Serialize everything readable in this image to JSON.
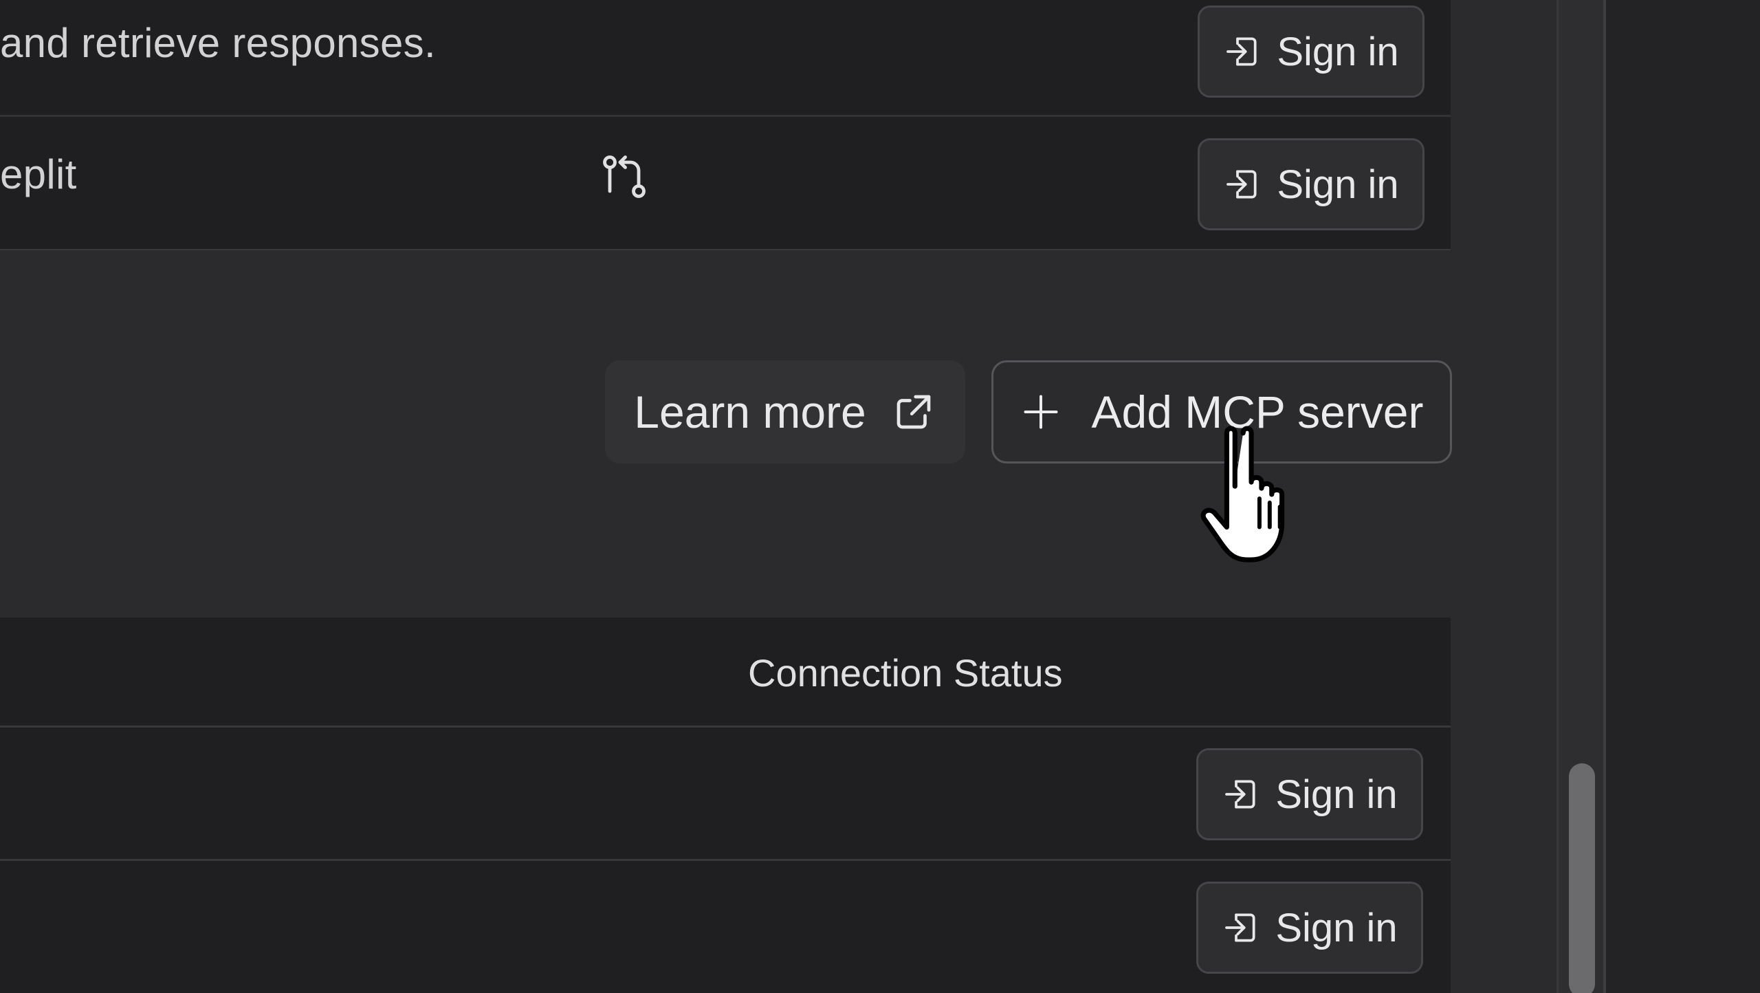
{
  "top_list": {
    "rows": [
      {
        "text": "and retrieve responses.",
        "action_label": "Sign in"
      },
      {
        "text": "eplit",
        "action_label": "Sign in"
      }
    ]
  },
  "actions": {
    "learn_more_label": "Learn more",
    "add_server_label": "Add MCP server"
  },
  "table": {
    "column_header": "Connection Status",
    "rows": [
      {
        "action_label": "Sign in"
      },
      {
        "action_label": "Sign in"
      }
    ]
  },
  "icons": {
    "sign_in": "sign-in-icon",
    "branch": "git-pull-request-icon",
    "external_link": "external-link-icon",
    "plus": "plus-icon"
  },
  "colors": {
    "background": "#2b2b2d",
    "card": "#1f1f21",
    "button": "#2e2e31",
    "border": "#45454a",
    "text": "#e8e8ea"
  }
}
